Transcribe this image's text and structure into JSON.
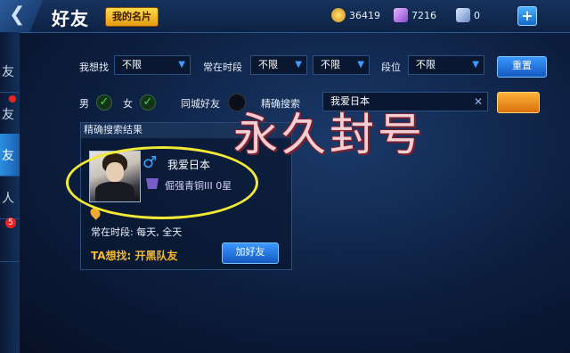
{
  "header": {
    "title": "好友",
    "my_card_label": "我的名片",
    "gold": "36419",
    "diamond": "7216",
    "coupon": "0",
    "plus_label": "+"
  },
  "sidebar": {
    "tabs": [
      {
        "label": "友"
      },
      {
        "label": "友"
      },
      {
        "label": "友"
      },
      {
        "label": "人"
      },
      {
        "label": ""
      }
    ],
    "badge_count": "5"
  },
  "filters": {
    "want_label": "我想找",
    "want_value": "不限",
    "online_label": "常在时段",
    "online_value1": "不限",
    "online_value2": "不限",
    "rank_label": "段位",
    "rank_value": "不限",
    "reset_label": "重置",
    "male_label": "男",
    "female_label": "女",
    "city_label": "同城好友",
    "exact_label": "精确搜索",
    "search_value": "我爱日本"
  },
  "results": {
    "header": "精确搜索结果",
    "player_name": "我爱日本",
    "rank_text": "倔强青铜III 0星",
    "online_time": "常在时段: 每天, 全天",
    "ta_wants": "TA想找: 开黑队友",
    "add_friend_label": "加好友"
  },
  "overlay_text": "永久封号",
  "colors": {
    "accent_blue": "#1a6fd0",
    "gold_button": "#e59a10",
    "highlight_yellow": "#f1e933",
    "check_green": "#3be048"
  }
}
